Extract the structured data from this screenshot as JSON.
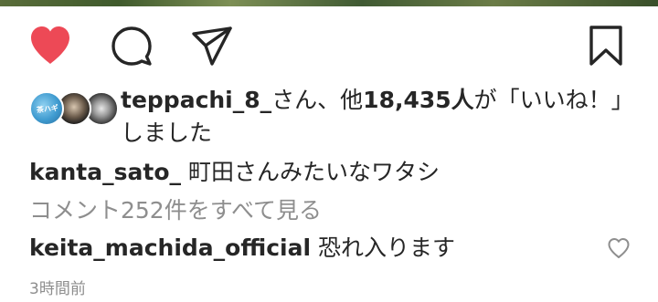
{
  "post": {
    "actions": {
      "like_icon": "heart-filled-icon",
      "like_color": "#ed4956",
      "comment_icon": "comment-bubble-icon",
      "share_icon": "paper-plane-icon",
      "save_icon": "bookmark-icon"
    },
    "likes": {
      "user": "teppachi_8_",
      "text_before_count": "さん、他",
      "count": "18,435人",
      "text_after_count": "が「いいね！」しました",
      "avatar_badge_text": "茶ハギ"
    },
    "caption": {
      "user": "kanta_sato_",
      "text": "町田さんみたいなワタシ"
    },
    "view_comments_label": "コメント252件をすべて見る",
    "comment": {
      "user": "keita_machida_official",
      "text": "恐れ入ります",
      "like_icon": "heart-outline-icon"
    },
    "timestamp": "3時間前"
  }
}
